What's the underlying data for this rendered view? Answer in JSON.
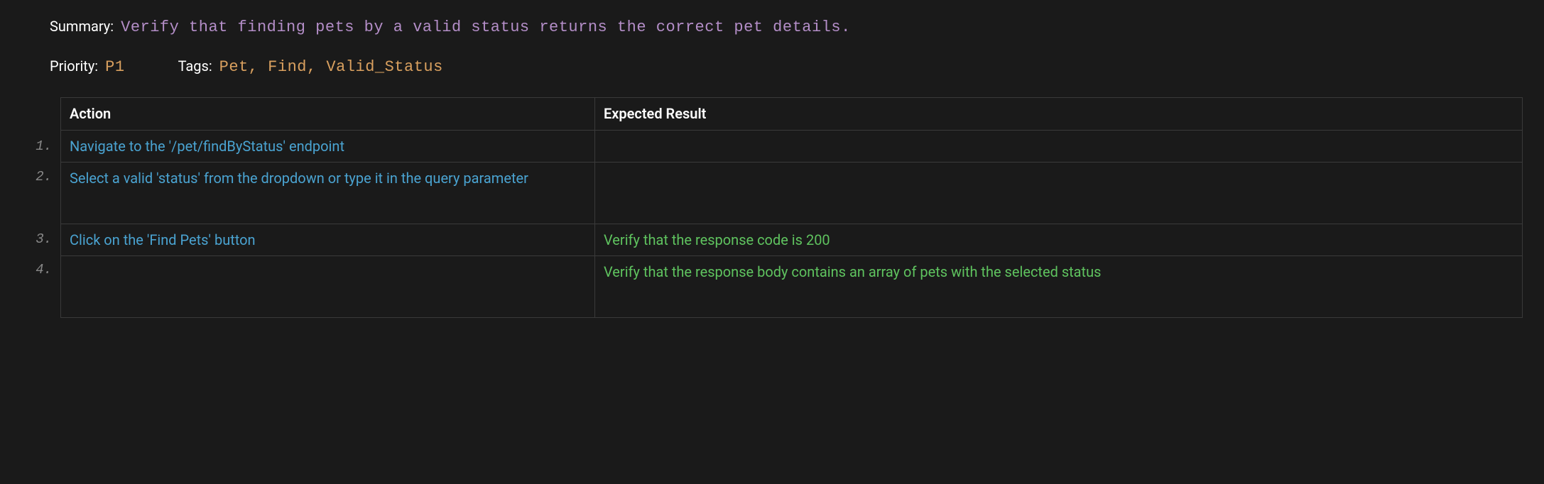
{
  "labels": {
    "summary": "Summary:",
    "priority": "Priority:",
    "tags": "Tags:"
  },
  "summary": "Verify that finding pets by a valid status returns the correct pet details.",
  "priority": "P1",
  "tags": "Pet, Find, Valid_Status",
  "columns": {
    "action": "Action",
    "expected": "Expected Result"
  },
  "steps": [
    {
      "num": "1.",
      "action": "Navigate to the '/pet/findByStatus' endpoint",
      "expected": ""
    },
    {
      "num": "2.",
      "action": "Select a valid 'status' from the dropdown or type it in the query parameter",
      "expected": ""
    },
    {
      "num": "3.",
      "action": "Click on the 'Find Pets' button",
      "expected": "Verify that the response code is 200"
    },
    {
      "num": "4.",
      "action": "",
      "expected": "Verify that the response body contains an array of pets with the selected status"
    }
  ]
}
